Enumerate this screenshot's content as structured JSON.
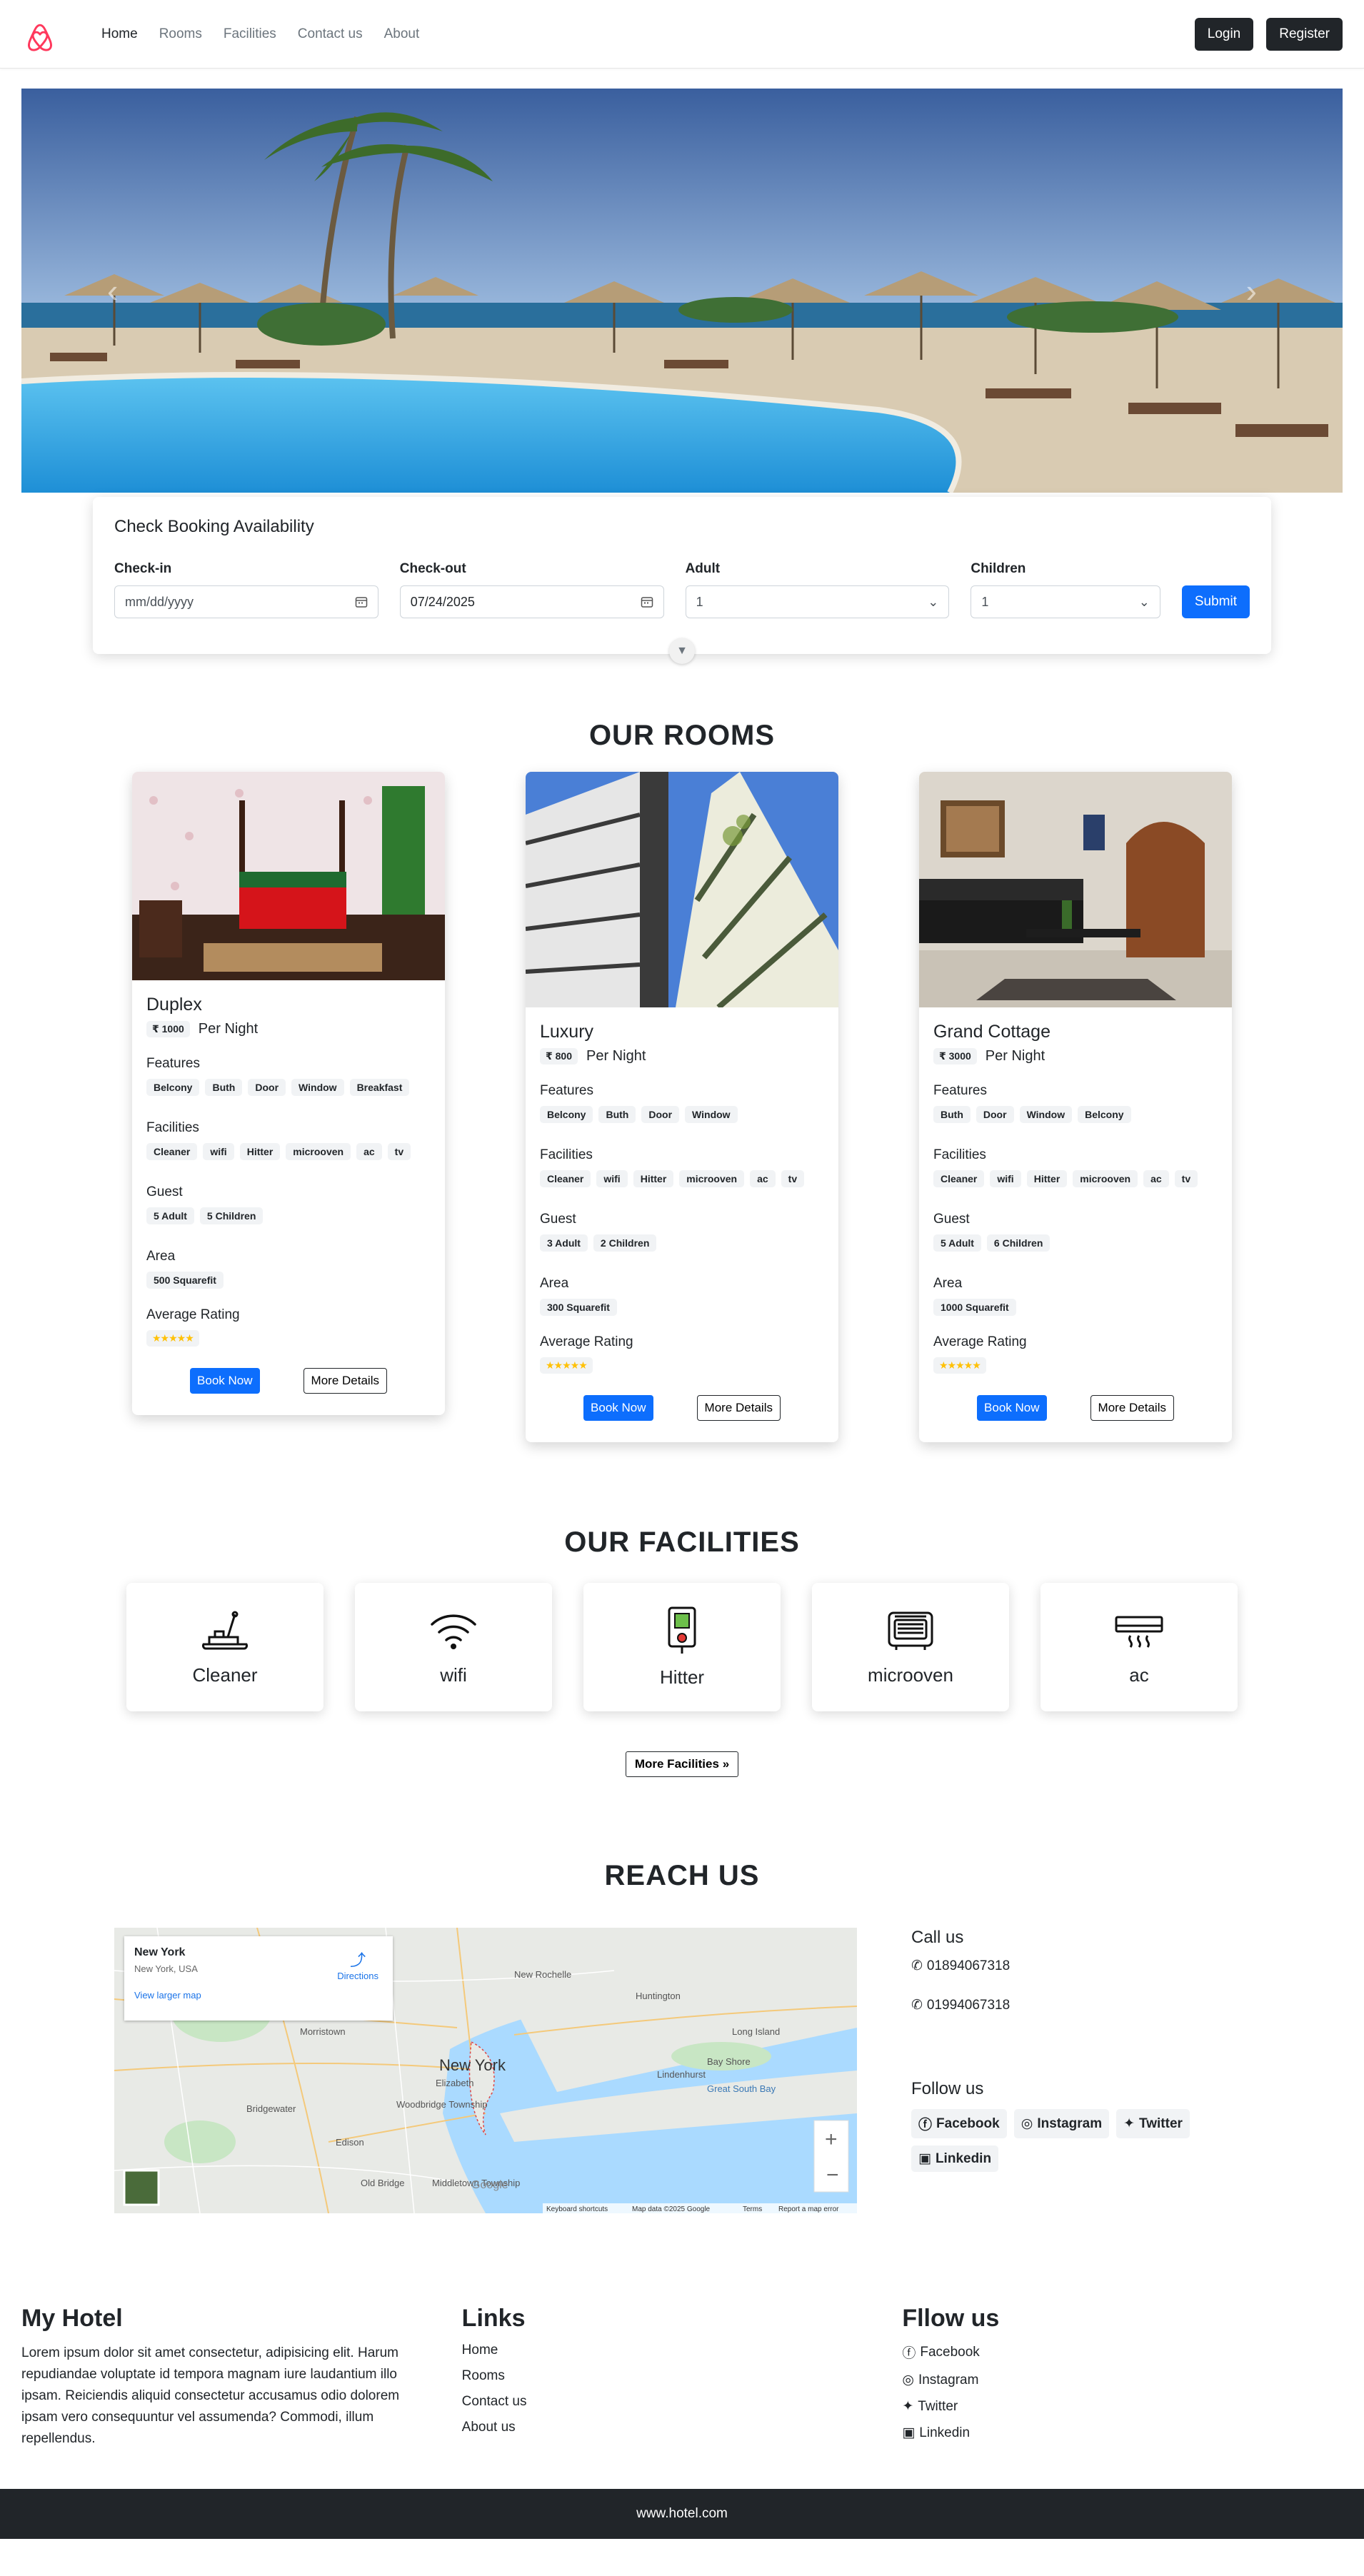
{
  "nav": {
    "links": [
      "Home",
      "Rooms",
      "Facilities",
      "Contact us",
      "About"
    ],
    "login": "Login",
    "register": "Register"
  },
  "booking": {
    "title": "Check Booking Availability",
    "checkin_label": "Check-in",
    "checkin_value": "mm/dd/yyyy",
    "checkout_label": "Check-out",
    "checkout_value": "07/24/2025",
    "adult_label": "Adult",
    "adult_value": "1",
    "children_label": "Children",
    "children_value": "1",
    "submit": "Submit"
  },
  "rooms": {
    "title": "OUR ROOMS",
    "per_night": "Per Night",
    "features_label": "Features",
    "facilities_label": "Facilities",
    "guest_label": "Guest",
    "area_label": "Area",
    "rating_label": "Average Rating",
    "book_now": "Book Now",
    "more_details": "More Details",
    "items": [
      {
        "name": "Duplex",
        "price": "₹ 1000",
        "features": [
          "Belcony",
          "Buth",
          "Door",
          "Window",
          "Breakfast"
        ],
        "facilities": [
          "Cleaner",
          "wifi",
          "Hitter",
          "microoven",
          "ac",
          "tv"
        ],
        "guest": [
          "5 Adult",
          "5 Children"
        ],
        "area": "500  Squarefit",
        "rating": "★★★★★"
      },
      {
        "name": "Luxury",
        "price": "₹ 800",
        "features": [
          "Belcony",
          "Buth",
          "Door",
          "Window"
        ],
        "facilities": [
          "Cleaner",
          "wifi",
          "Hitter",
          "microoven",
          "ac",
          "tv"
        ],
        "guest": [
          "3 Adult",
          "2 Children"
        ],
        "area": "300  Squarefit",
        "rating": "★★★★★"
      },
      {
        "name": "Grand Cottage",
        "price": "₹ 3000",
        "features": [
          "Buth",
          "Door",
          "Window",
          "Belcony"
        ],
        "facilities": [
          "Cleaner",
          "wifi",
          "Hitter",
          "microoven",
          "ac",
          "tv"
        ],
        "guest": [
          "5 Adult",
          "6 Children"
        ],
        "area": "1000  Squarefit",
        "rating": "★★★★★"
      }
    ]
  },
  "facilities": {
    "title": "OUR FACILITIES",
    "items": [
      {
        "name": "Cleaner",
        "icon": "cleaner-icon"
      },
      {
        "name": "wifi",
        "icon": "wifi-icon"
      },
      {
        "name": "Hitter",
        "icon": "heater-icon"
      },
      {
        "name": "microoven",
        "icon": "microwave-icon"
      },
      {
        "name": "ac",
        "icon": "ac-icon"
      }
    ],
    "more": "More Facilities"
  },
  "reach": {
    "title": "REACH US",
    "map": {
      "place": "New York",
      "address": "New York, USA",
      "directions": "Directions",
      "larger_map": "View larger map",
      "city_label": "New York",
      "labels": [
        "New Rochelle",
        "Huntington",
        "Morristown",
        "Long Island",
        "Bay Shore",
        "Lindenhurst",
        "Great South Bay",
        "Elizabeth",
        "Bridgewater",
        "Woodbridge Township",
        "Edison",
        "Old Bridge",
        "Middletown Township"
      ],
      "footer": [
        "Keyboard shortcuts",
        "Map data ©2025 Google",
        "Terms",
        "Report a map error"
      ],
      "google": "Google"
    },
    "call_title": "Call us",
    "phones": [
      "01894067318",
      "01994067318"
    ],
    "follow_title": "Follow us",
    "socials": [
      "Facebook",
      "Instagram",
      "Twitter",
      "Linkedin"
    ]
  },
  "footer": {
    "brand": "My Hotel",
    "about": "Lorem ipsum dolor sit amet consectetur, adipisicing elit. Harum repudiandae voluptate id tempora magnam iure laudantium illo ipsam. Reiciendis aliquid consectetur accusamus odio dolorem ipsam vero consequuntur vel assumenda? Commodi, illum repellendus.",
    "links_title": "Links",
    "links": [
      "Home",
      "Rooms",
      "Contact us",
      "About us"
    ],
    "follow_title": "Fllow us",
    "socials": [
      "Facebook",
      "Instagram",
      "Twitter",
      "Linkedin"
    ],
    "copyright": "www.hotel.com"
  },
  "colors": {
    "primary": "#0d6efd",
    "dark": "#212529",
    "brand": "#ff385c",
    "star": "#ffc107"
  }
}
